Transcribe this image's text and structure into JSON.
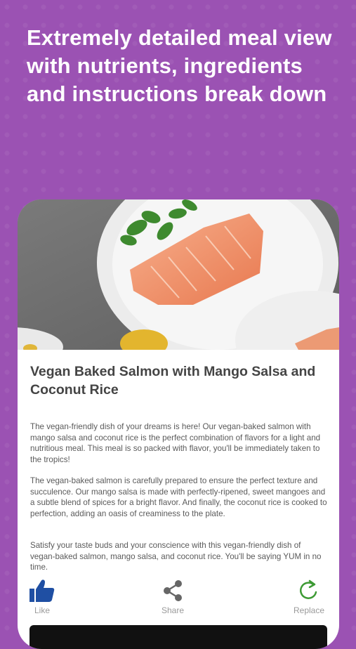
{
  "headline": "Extremely detailed meal view with nutrients, ingredients and instructions break down",
  "meal": {
    "title": "Vegan Baked Salmon with Mango Salsa and Coconut Rice",
    "paragraphs": [
      "The vegan-friendly dish of your dreams is here! Our vegan-baked salmon with mango salsa and coconut rice is the perfect combination of flavors for a light and nutritious meal. This meal is so packed with flavor, you'll be immediately taken to the tropics!",
      "The vegan-baked salmon is carefully prepared to ensure the perfect texture and succulence. Our mango salsa is made with perfectly-ripened, sweet mangoes and a subtle blend of spices for a bright flavor. And finally, the coconut rice is cooked to perfection, adding an oasis of creaminess to the plate.",
      "Satisfy your taste buds and your conscience with this vegan-friendly dish of vegan-baked salmon, mango salsa, and coconut rice. You'll be saying YUM in no time."
    ]
  },
  "actions": {
    "like": {
      "label": "Like",
      "icon": "thumbs-up-icon",
      "color": "#1f4fa3"
    },
    "share": {
      "label": "Share",
      "icon": "share-icon",
      "color": "#666666"
    },
    "replace": {
      "label": "Replace",
      "icon": "refresh-icon",
      "color": "#3d9a34"
    }
  },
  "colors": {
    "background": "#9b52b3",
    "card": "#ffffff"
  }
}
